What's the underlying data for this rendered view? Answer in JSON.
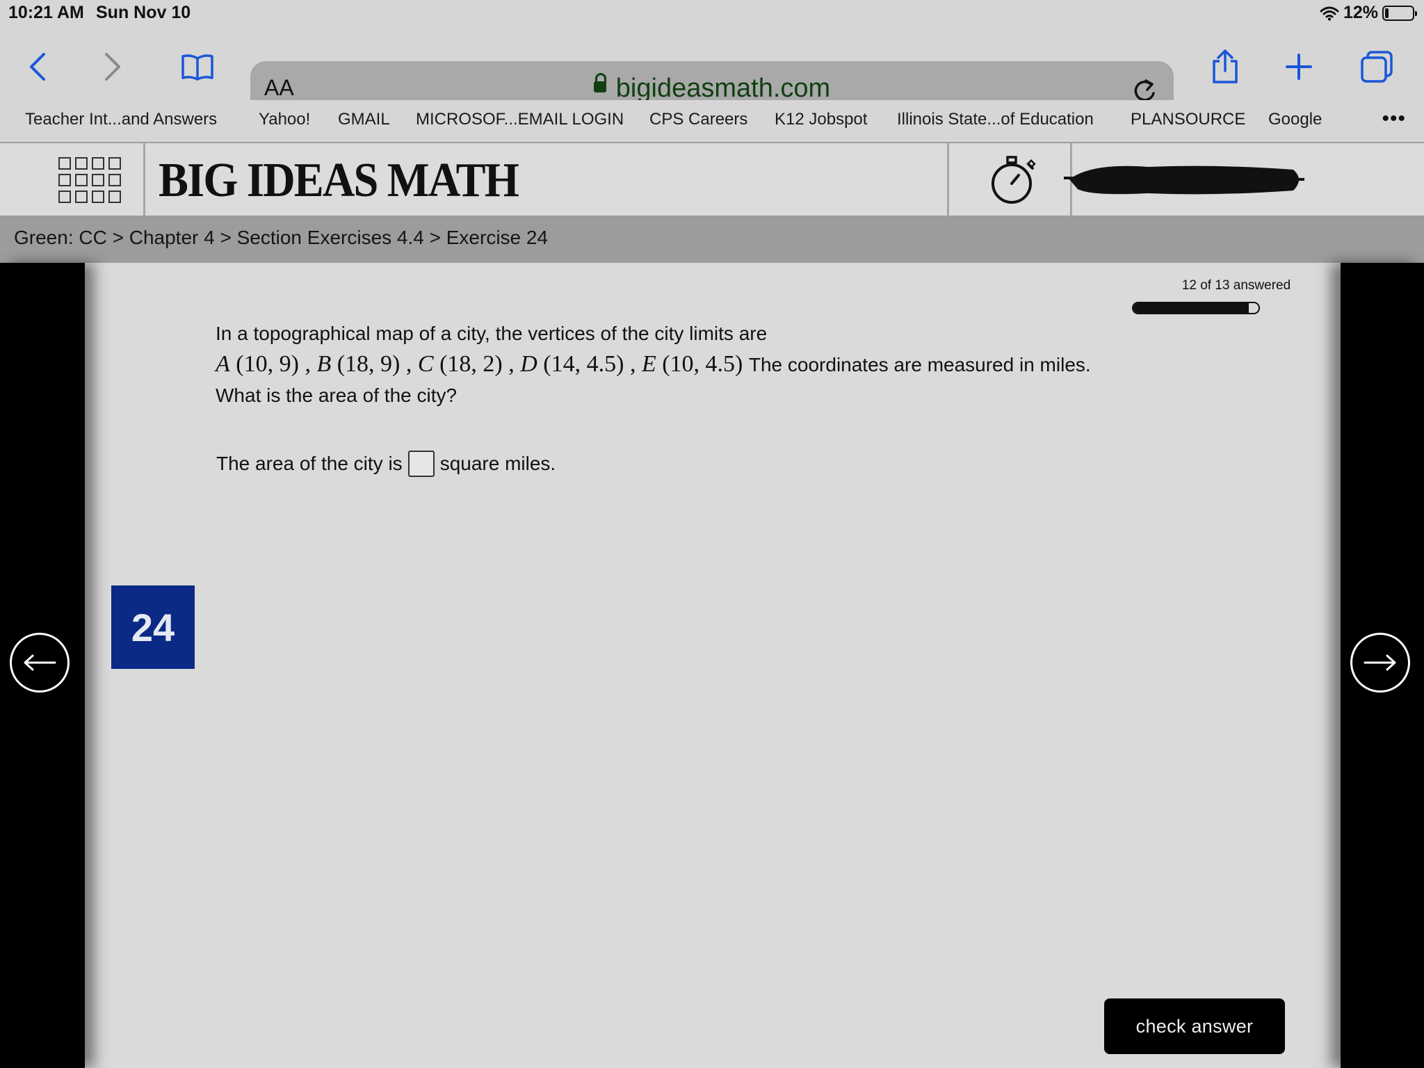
{
  "status_bar": {
    "time": "10:21 AM",
    "date": "Sun Nov 10",
    "battery": "12%",
    "battery_level": 0.12,
    "wifi_icon": "wifi-icon"
  },
  "browser": {
    "text_size_label": "AA",
    "url": "bigideasmath.com",
    "icons": [
      "back-icon",
      "forward-icon",
      "bookmarks-book-icon",
      "lock-icon",
      "reload-icon",
      "share-icon",
      "new-tab-plus-icon",
      "tabs-overview-icon"
    ]
  },
  "bookmarks": [
    "Teacher Int...and Answers",
    "Yahoo!",
    "GMAIL",
    "MICROSOF...EMAIL LOGIN",
    "CPS Careers",
    "K12 Jobspot",
    "Illinois State...of Education",
    "PLANSOURCE",
    "Google"
  ],
  "site": {
    "logo_text": "BIG IDEAS MATH",
    "icons": [
      "apps-grid-icon",
      "stopwatch-icon"
    ]
  },
  "breadcrumb": "Green: CC > Chapter 4 > Section Exercises 4.4 > Exercise 24",
  "progress": {
    "label": "12 of 13 answered",
    "answered": 12,
    "total": 13
  },
  "exercise": {
    "number": "24",
    "question_intro": "In a topographical map of a city, the vertices of the city limits are",
    "vertices": [
      {
        "name": "A",
        "coords": "(10, 9)"
      },
      {
        "name": "B",
        "coords": "(18, 9)"
      },
      {
        "name": "C",
        "coords": "(18, 2)"
      },
      {
        "name": "D",
        "coords": "(14, 4.5)"
      },
      {
        "name": "E",
        "coords": "(10, 4.5)"
      }
    ],
    "question_after": "The coordinates are measured in miles. What is the area of the city?",
    "answer_prefix": "The area of the city is",
    "answer_value": "",
    "answer_suffix": "square miles."
  },
  "buttons": {
    "check_answer": "check answer"
  }
}
